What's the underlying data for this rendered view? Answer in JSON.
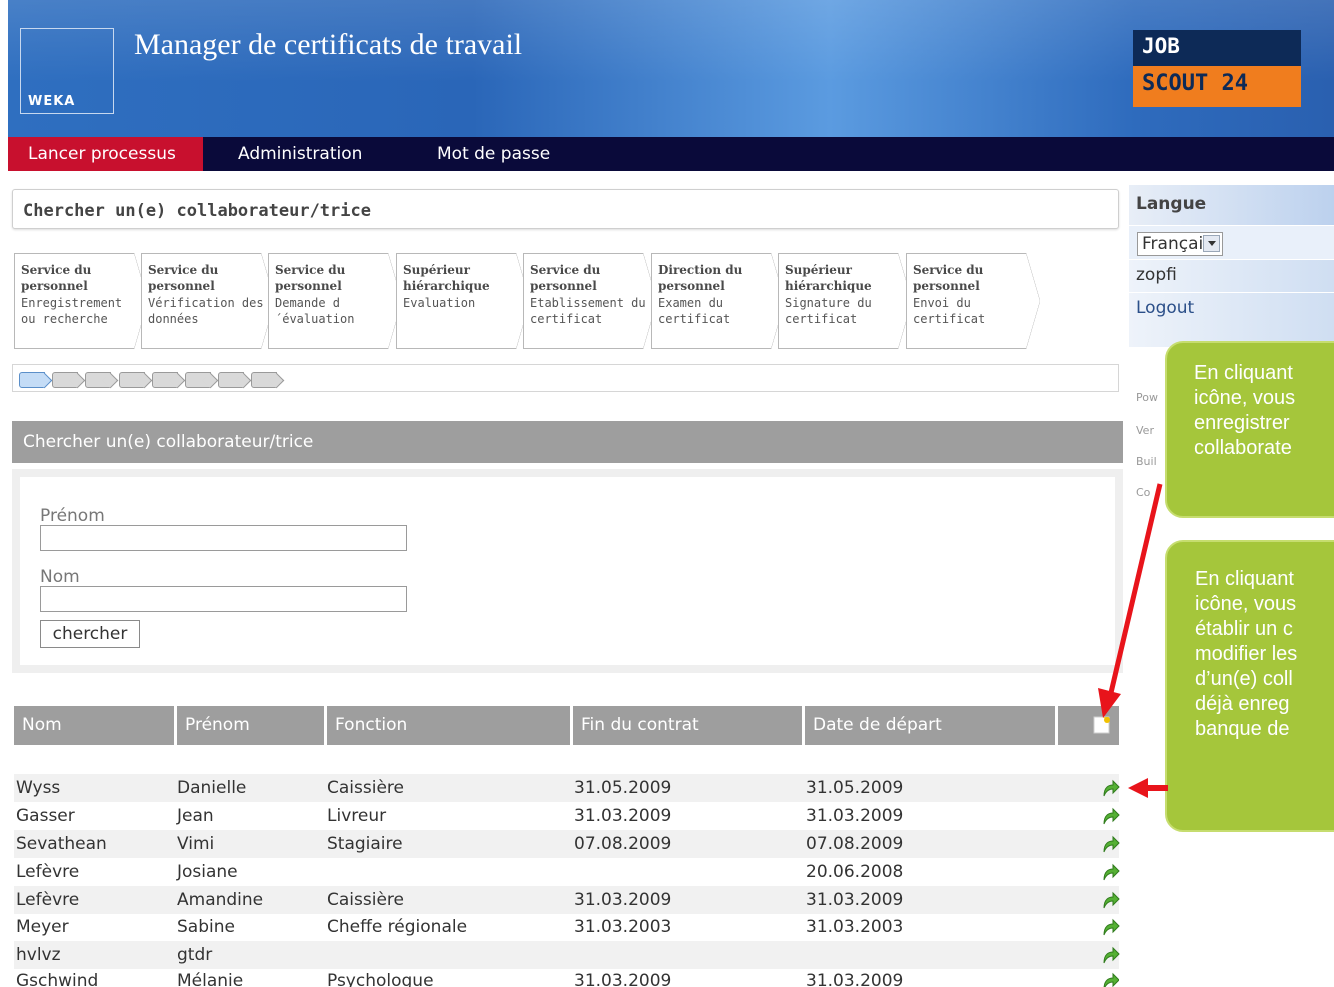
{
  "header": {
    "app_title": "Manager de certificats de travail",
    "weka_logo": "WEKA",
    "job_logo_top": "JOB",
    "job_logo_bottom": "SCOUT 24"
  },
  "nav": {
    "items": [
      "Lancer processus",
      "Administration",
      "Mot de passe"
    ],
    "active_color": "#c8102e"
  },
  "search_header": "Chercher un(e) collaborateur/trice",
  "steps": [
    {
      "title": "Service du personnel",
      "desc": "Enregistrement ou recherche"
    },
    {
      "title": "Service du personnel",
      "desc": "Vérification des données"
    },
    {
      "title": "Service du personnel",
      "desc": "Demande d´évaluation"
    },
    {
      "title": "Supérieur hiérarchique",
      "desc": "Evaluation"
    },
    {
      "title": "Service du personnel",
      "desc": "Etablissement du certificat"
    },
    {
      "title": "Direction du personnel",
      "desc": "Examen du certificat"
    },
    {
      "title": "Supérieur hiérarchique",
      "desc": "Signature du certificat"
    },
    {
      "title": "Service du personnel",
      "desc": "Envoi du certificat"
    }
  ],
  "progress": {
    "current_step": 1,
    "total_steps": 8
  },
  "search_panel": {
    "title": "Chercher un(e) collaborateur/trice",
    "firstname_label": "Prénom",
    "lastname_label": "Nom",
    "search_button": "chercher"
  },
  "table": {
    "columns": [
      "Nom",
      "Prénom",
      "Fonction",
      "Fin du contrat",
      "Date de départ"
    ],
    "rows": [
      [
        "Wyss",
        "Danielle",
        "Caissière",
        "31.05.2009",
        "31.05.2009"
      ],
      [
        "Gasser",
        "Jean",
        "Livreur",
        "31.03.2009",
        "31.03.2009"
      ],
      [
        "Sevathean",
        "Vimi",
        "Stagiaire",
        "07.08.2009",
        "07.08.2009"
      ],
      [
        "Lefèvre",
        "Josiane",
        "",
        "",
        "20.06.2008"
      ],
      [
        "Lefèvre",
        "Amandine",
        "Caissière",
        "31.03.2009",
        "31.03.2009"
      ],
      [
        "Meyer",
        "Sabine",
        "Cheffe régionale",
        "31.03.2003",
        "31.03.2003"
      ],
      [
        "hvlvz",
        "gtdr",
        "",
        "",
        ""
      ],
      [
        "Gschwind",
        "Mélanie",
        "Psychologue",
        "31.03.2009",
        "31.03.2009"
      ]
    ]
  },
  "sidebar": {
    "language_label": "Langue",
    "language_value": "Français",
    "username": "zopfi",
    "logout": "Logout",
    "footer_lines": [
      "Pow",
      "Ver",
      "Buil",
      "Co"
    ]
  },
  "callouts": {
    "first": [
      "En cliquant",
      "icône, vous",
      "enregistrer",
      "collaborate"
    ],
    "second": [
      "En cliquant",
      "icône, vous",
      "établir un c",
      "modifier les",
      "d’un(e) coll",
      "déjà enreg",
      "banque de"
    ]
  }
}
